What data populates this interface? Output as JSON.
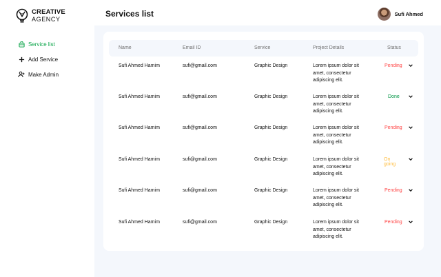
{
  "brand": {
    "line1": "CREATIVE",
    "line2": "AGENCY"
  },
  "nav": [
    {
      "label": "Service list",
      "icon": "bag-icon",
      "active": true
    },
    {
      "label": "Add Service",
      "icon": "plus-icon",
      "active": false
    },
    {
      "label": "Make Admin",
      "icon": "add-user-icon",
      "active": false
    }
  ],
  "header": {
    "title": "Services list",
    "user_name": "Sufi Ahmed"
  },
  "table": {
    "columns": [
      "Name",
      "Email ID",
      "Service",
      "Project Details",
      "Status"
    ],
    "rows": [
      {
        "name": "Sufi Ahmed Hamim",
        "email": "sufi@gmail.com",
        "service": "Graphic Design",
        "details": "Lorem ipsum dolor sit amet, consectetur adipiscing elit.",
        "status": "Pending"
      },
      {
        "name": "Sufi Ahmed Hamim",
        "email": "sufi@gmail.com",
        "service": "Graphic Design",
        "details": "Lorem ipsum dolor sit amet, consectetur adipiscing elit.",
        "status": "Done"
      },
      {
        "name": "Sufi Ahmed Hamim",
        "email": "sufi@gmail.com",
        "service": "Graphic Design",
        "details": "Lorem ipsum dolor sit amet, consectetur adipiscing elit.",
        "status": "Pending"
      },
      {
        "name": "Sufi Ahmed Hamim",
        "email": "sufi@gmail.com",
        "service": "Graphic Design",
        "details": "Lorem ipsum dolor sit amet, consectetur adipiscing elit.",
        "status": "On going"
      },
      {
        "name": "Sufi Ahmed Hamim",
        "email": "sufi@gmail.com",
        "service": "Graphic Design",
        "details": "Lorem ipsum dolor sit amet, consectetur adipiscing elit.",
        "status": "Pending"
      },
      {
        "name": "Sufi Ahmed Hamim",
        "email": "sufi@gmail.com",
        "service": "Graphic Design",
        "details": "Lorem ipsum dolor sit amet, consectetur adipiscing elit.",
        "status": "Pending"
      }
    ]
  },
  "status_colors": {
    "Pending": "#ff4545",
    "Done": "#009444",
    "On going": "#ffbd3e"
  },
  "accent": "#0ea54b"
}
